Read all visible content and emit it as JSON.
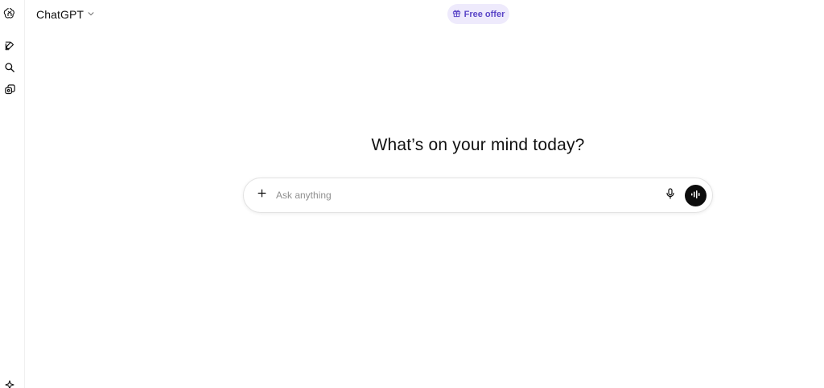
{
  "header": {
    "model_name": "ChatGPT",
    "free_offer_label": "Free offer"
  },
  "sidebar": {
    "items": [
      {
        "icon": "openai-logo-icon"
      },
      {
        "icon": "new-chat-icon"
      },
      {
        "icon": "search-icon"
      },
      {
        "icon": "library-icon"
      },
      {
        "icon": "sparkle-icon"
      }
    ]
  },
  "main": {
    "heading": "What’s on your mind today?"
  },
  "composer": {
    "placeholder": "Ask anything",
    "value": ""
  },
  "colors": {
    "accent_purple": "#5b46c7",
    "offer_bg": "#eeeafc",
    "voice_button_bg": "#0d0d0d"
  }
}
